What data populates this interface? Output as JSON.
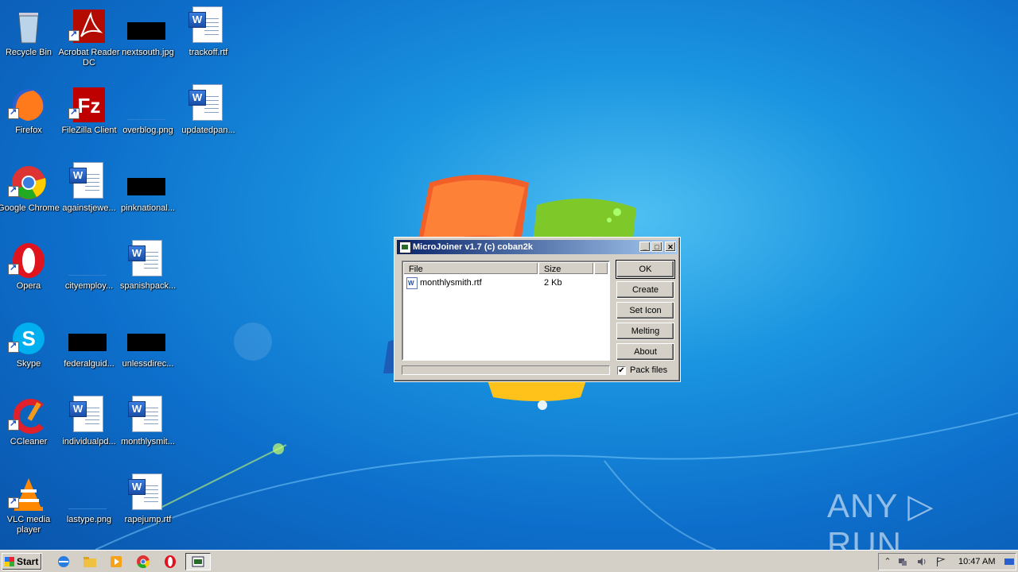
{
  "desktop": {
    "icons": [
      {
        "label": "Recycle Bin"
      },
      {
        "label": "Acrobat Reader DC"
      },
      {
        "label": "nextsouth.jpg"
      },
      {
        "label": "trackoff.rtf"
      },
      {
        "label": "Firefox"
      },
      {
        "label": "FileZilla Client"
      },
      {
        "label": "overblog.png"
      },
      {
        "label": "updatedpan..."
      },
      {
        "label": "Google Chrome"
      },
      {
        "label": "againstjewe..."
      },
      {
        "label": "pinknational..."
      },
      {
        "label": "Opera"
      },
      {
        "label": "cityemploy..."
      },
      {
        "label": "spanishpack..."
      },
      {
        "label": "Skype"
      },
      {
        "label": "federalguid..."
      },
      {
        "label": "unlessdirec..."
      },
      {
        "label": "CCleaner"
      },
      {
        "label": "individualpd..."
      },
      {
        "label": "monthlysmit..."
      },
      {
        "label": "VLC media player"
      },
      {
        "label": "lastype.png"
      },
      {
        "label": "rapejump.rtf"
      }
    ]
  },
  "dialog": {
    "title": "MicroJoiner v1.7 (c) coban2k",
    "minimize": "_",
    "maximize": "□",
    "close": "✕",
    "columns": {
      "file": "File",
      "size": "Size"
    },
    "rows": [
      {
        "file": "monthlysmith.rtf",
        "size": "2 Kb"
      }
    ],
    "buttons": {
      "ok": "OK",
      "create": "Create",
      "set_icon": "Set Icon",
      "melting": "Melting",
      "about": "About"
    },
    "pack_files_label": "Pack files",
    "pack_files_checked": "✔",
    "progress": 0
  },
  "watermark": {
    "text": "ANY ▷ RUN"
  },
  "taskbar": {
    "start_label": "Start",
    "clock": "10:47 AM",
    "tray_up": "⌃"
  }
}
